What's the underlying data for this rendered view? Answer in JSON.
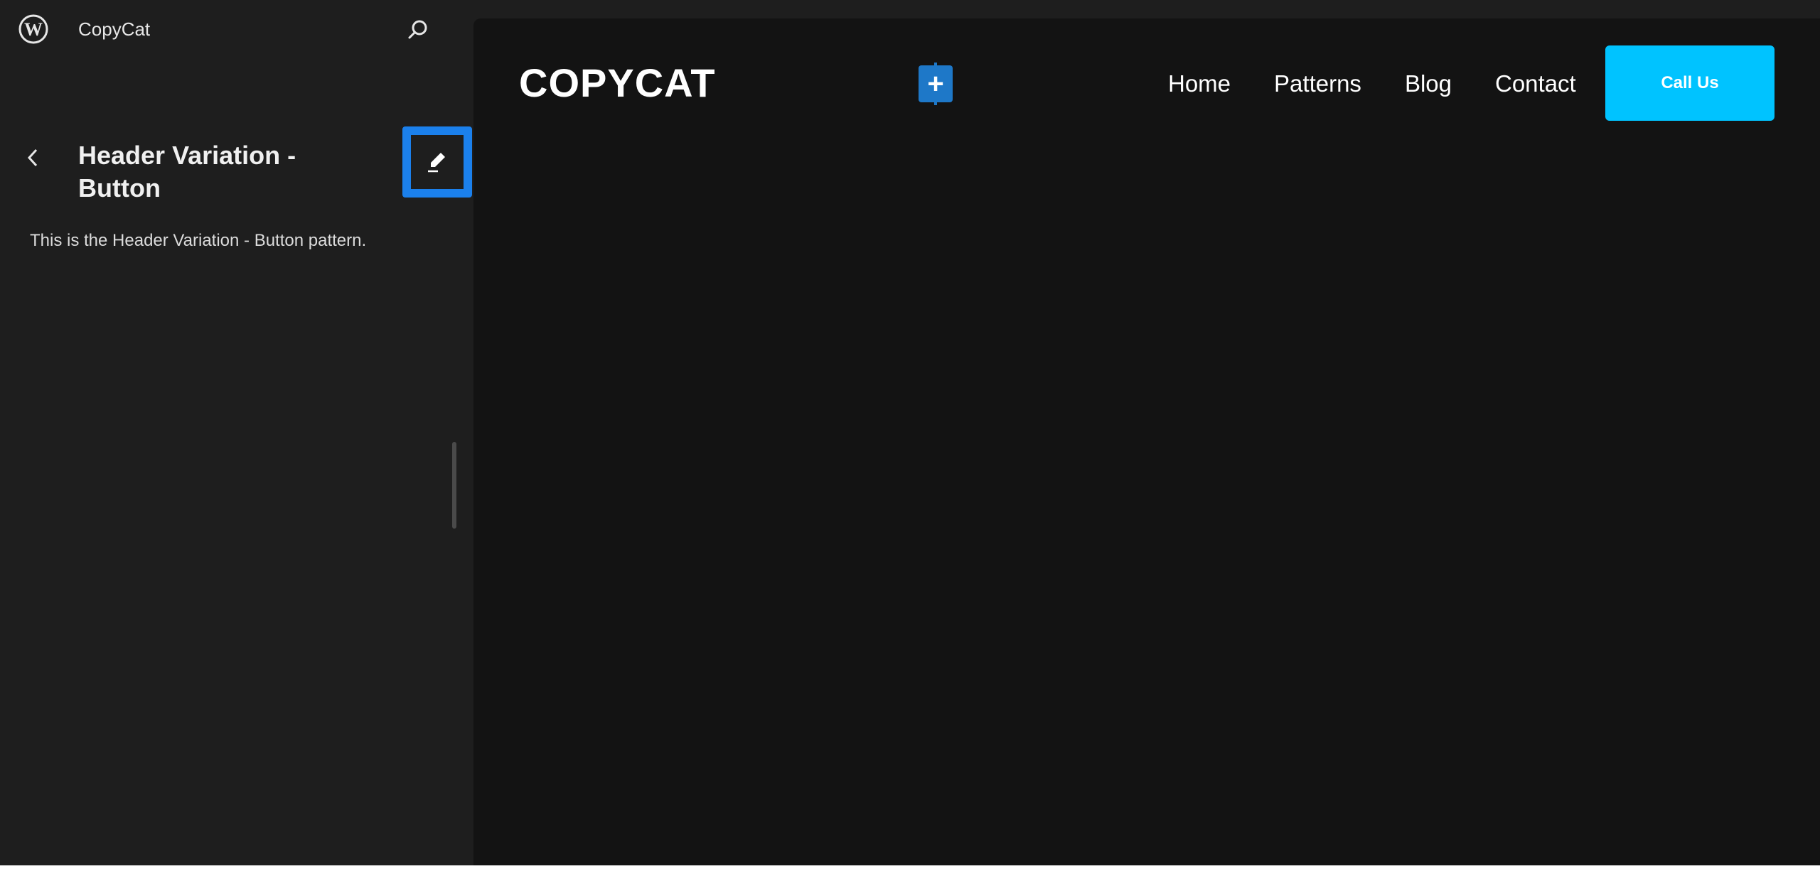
{
  "app": {
    "site_title": "CopyCat",
    "logo_icon": "wordpress-logo-icon",
    "search_icon": "search-icon"
  },
  "sidebar": {
    "back_icon": "chevron-left-icon",
    "pattern_title": "Header Variation - Button",
    "edit_icon": "pencil-icon",
    "description": "This is the Header Variation - Button pattern."
  },
  "canvas": {
    "brand": "COPYCAT",
    "inserter_label": "+",
    "nav": [
      "Home",
      "Patterns",
      "Blog",
      "Contact"
    ],
    "cta_label": "Call Us"
  },
  "colors": {
    "sidebar_bg": "#1e1e1e",
    "canvas_bg": "#131313",
    "highlight": "#1b80ec",
    "cta_bg": "#00c3ff",
    "inserter_bg": "#1e78c8"
  }
}
